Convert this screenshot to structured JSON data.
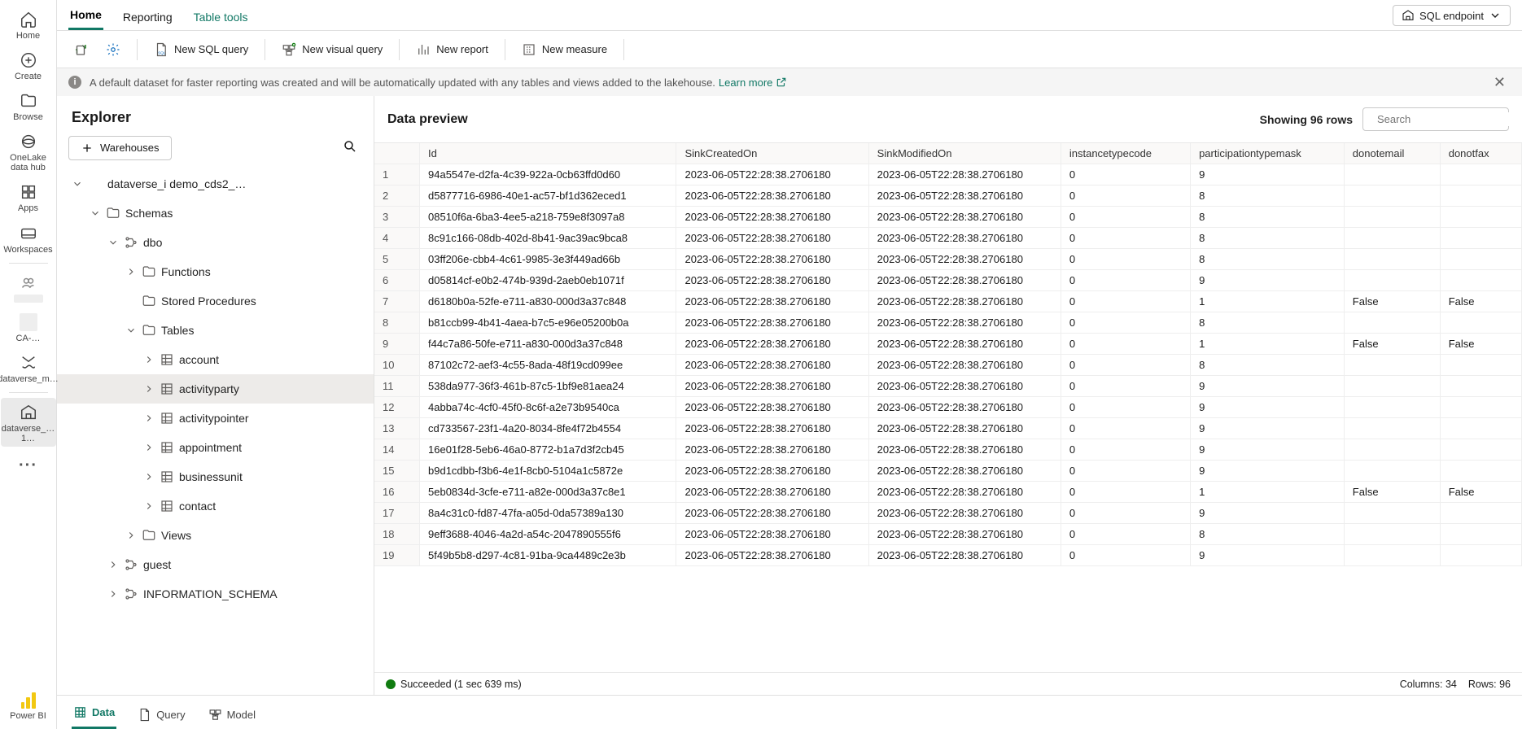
{
  "rail": {
    "home": "Home",
    "create": "Create",
    "browse": "Browse",
    "onelake": "OneLake data hub",
    "apps": "Apps",
    "workspaces": "Workspaces",
    "ws_avatar": "",
    "ws_ca": "CA-…",
    "ws_dvm": "dataverse_m…",
    "ws_dvi": "dataverse_…1…",
    "powerbi": "Power BI"
  },
  "tabs": {
    "home": "Home",
    "reporting": "Reporting",
    "tabletools": "Table tools",
    "mode": "SQL endpoint"
  },
  "toolbar": {
    "refresh": "",
    "settings": "",
    "newsql": "New SQL query",
    "newvisual": "New visual query",
    "newreport": "New report",
    "newmeasure": "New measure"
  },
  "banner": {
    "text": "A default dataset for faster reporting was created and will be automatically updated with any tables and views added to the lakehouse.",
    "learn": "Learn more"
  },
  "explorer": {
    "title": "Explorer",
    "warehouses": "Warehouses",
    "root": "dataverse_i          demo_cds2_…",
    "schemas": "Schemas",
    "dbo": "dbo",
    "functions": "Functions",
    "sprocs": "Stored Procedures",
    "tables": "Tables",
    "table_list": [
      "account",
      "activityparty",
      "activitypointer",
      "appointment",
      "businessunit",
      "contact"
    ],
    "views": "Views",
    "guest": "guest",
    "infoschema": "INFORMATION_SCHEMA"
  },
  "preview": {
    "title": "Data preview",
    "showing": "Showing 96 rows",
    "search_ph": "Search",
    "columns": [
      "Id",
      "SinkCreatedOn",
      "SinkModifiedOn",
      "instancetypecode",
      "participationtypemask",
      "donotemail",
      "donotfax"
    ],
    "rows": [
      {
        "n": 1,
        "Id": "94a5547e-d2fa-4c39-922a-0cb63ffd0d60",
        "SinkCreatedOn": "2023-06-05T22:28:38.2706180",
        "SinkModifiedOn": "2023-06-05T22:28:38.2706180",
        "instancetypecode": "0",
        "participationtypemask": "9",
        "donotemail": "",
        "donotfax": ""
      },
      {
        "n": 2,
        "Id": "d5877716-6986-40e1-ac57-bf1d362eced1",
        "SinkCreatedOn": "2023-06-05T22:28:38.2706180",
        "SinkModifiedOn": "2023-06-05T22:28:38.2706180",
        "instancetypecode": "0",
        "participationtypemask": "8",
        "donotemail": "",
        "donotfax": ""
      },
      {
        "n": 3,
        "Id": "08510f6a-6ba3-4ee5-a218-759e8f3097a8",
        "SinkCreatedOn": "2023-06-05T22:28:38.2706180",
        "SinkModifiedOn": "2023-06-05T22:28:38.2706180",
        "instancetypecode": "0",
        "participationtypemask": "8",
        "donotemail": "",
        "donotfax": ""
      },
      {
        "n": 4,
        "Id": "8c91c166-08db-402d-8b41-9ac39ac9bca8",
        "SinkCreatedOn": "2023-06-05T22:28:38.2706180",
        "SinkModifiedOn": "2023-06-05T22:28:38.2706180",
        "instancetypecode": "0",
        "participationtypemask": "8",
        "donotemail": "",
        "donotfax": ""
      },
      {
        "n": 5,
        "Id": "03ff206e-cbb4-4c61-9985-3e3f449ad66b",
        "SinkCreatedOn": "2023-06-05T22:28:38.2706180",
        "SinkModifiedOn": "2023-06-05T22:28:38.2706180",
        "instancetypecode": "0",
        "participationtypemask": "8",
        "donotemail": "",
        "donotfax": ""
      },
      {
        "n": 6,
        "Id": "d05814cf-e0b2-474b-939d-2aeb0eb1071f",
        "SinkCreatedOn": "2023-06-05T22:28:38.2706180",
        "SinkModifiedOn": "2023-06-05T22:28:38.2706180",
        "instancetypecode": "0",
        "participationtypemask": "9",
        "donotemail": "",
        "donotfax": ""
      },
      {
        "n": 7,
        "Id": "d6180b0a-52fe-e711-a830-000d3a37c848",
        "SinkCreatedOn": "2023-06-05T22:28:38.2706180",
        "SinkModifiedOn": "2023-06-05T22:28:38.2706180",
        "instancetypecode": "0",
        "participationtypemask": "1",
        "donotemail": "False",
        "donotfax": "False"
      },
      {
        "n": 8,
        "Id": "b81ccb99-4b41-4aea-b7c5-e96e05200b0a",
        "SinkCreatedOn": "2023-06-05T22:28:38.2706180",
        "SinkModifiedOn": "2023-06-05T22:28:38.2706180",
        "instancetypecode": "0",
        "participationtypemask": "8",
        "donotemail": "",
        "donotfax": ""
      },
      {
        "n": 9,
        "Id": "f44c7a86-50fe-e711-a830-000d3a37c848",
        "SinkCreatedOn": "2023-06-05T22:28:38.2706180",
        "SinkModifiedOn": "2023-06-05T22:28:38.2706180",
        "instancetypecode": "0",
        "participationtypemask": "1",
        "donotemail": "False",
        "donotfax": "False"
      },
      {
        "n": 10,
        "Id": "87102c72-aef3-4c55-8ada-48f19cd099ee",
        "SinkCreatedOn": "2023-06-05T22:28:38.2706180",
        "SinkModifiedOn": "2023-06-05T22:28:38.2706180",
        "instancetypecode": "0",
        "participationtypemask": "8",
        "donotemail": "",
        "donotfax": ""
      },
      {
        "n": 11,
        "Id": "538da977-36f3-461b-87c5-1bf9e81aea24",
        "SinkCreatedOn": "2023-06-05T22:28:38.2706180",
        "SinkModifiedOn": "2023-06-05T22:28:38.2706180",
        "instancetypecode": "0",
        "participationtypemask": "9",
        "donotemail": "",
        "donotfax": ""
      },
      {
        "n": 12,
        "Id": "4abba74c-4cf0-45f0-8c6f-a2e73b9540ca",
        "SinkCreatedOn": "2023-06-05T22:28:38.2706180",
        "SinkModifiedOn": "2023-06-05T22:28:38.2706180",
        "instancetypecode": "0",
        "participationtypemask": "9",
        "donotemail": "",
        "donotfax": ""
      },
      {
        "n": 13,
        "Id": "cd733567-23f1-4a20-8034-8fe4f72b4554",
        "SinkCreatedOn": "2023-06-05T22:28:38.2706180",
        "SinkModifiedOn": "2023-06-05T22:28:38.2706180",
        "instancetypecode": "0",
        "participationtypemask": "9",
        "donotemail": "",
        "donotfax": ""
      },
      {
        "n": 14,
        "Id": "16e01f28-5eb6-46a0-8772-b1a7d3f2cb45",
        "SinkCreatedOn": "2023-06-05T22:28:38.2706180",
        "SinkModifiedOn": "2023-06-05T22:28:38.2706180",
        "instancetypecode": "0",
        "participationtypemask": "9",
        "donotemail": "",
        "donotfax": ""
      },
      {
        "n": 15,
        "Id": "b9d1cdbb-f3b6-4e1f-8cb0-5104a1c5872e",
        "SinkCreatedOn": "2023-06-05T22:28:38.2706180",
        "SinkModifiedOn": "2023-06-05T22:28:38.2706180",
        "instancetypecode": "0",
        "participationtypemask": "9",
        "donotemail": "",
        "donotfax": ""
      },
      {
        "n": 16,
        "Id": "5eb0834d-3cfe-e711-a82e-000d3a37c8e1",
        "SinkCreatedOn": "2023-06-05T22:28:38.2706180",
        "SinkModifiedOn": "2023-06-05T22:28:38.2706180",
        "instancetypecode": "0",
        "participationtypemask": "1",
        "donotemail": "False",
        "donotfax": "False"
      },
      {
        "n": 17,
        "Id": "8a4c31c0-fd87-47fa-a05d-0da57389a130",
        "SinkCreatedOn": "2023-06-05T22:28:38.2706180",
        "SinkModifiedOn": "2023-06-05T22:28:38.2706180",
        "instancetypecode": "0",
        "participationtypemask": "9",
        "donotemail": "",
        "donotfax": ""
      },
      {
        "n": 18,
        "Id": "9eff3688-4046-4a2d-a54c-2047890555f6",
        "SinkCreatedOn": "2023-06-05T22:28:38.2706180",
        "SinkModifiedOn": "2023-06-05T22:28:38.2706180",
        "instancetypecode": "0",
        "participationtypemask": "8",
        "donotemail": "",
        "donotfax": ""
      },
      {
        "n": 19,
        "Id": "5f49b5b8-d297-4c81-91ba-9ca4489c2e3b",
        "SinkCreatedOn": "2023-06-05T22:28:38.2706180",
        "SinkModifiedOn": "2023-06-05T22:28:38.2706180",
        "instancetypecode": "0",
        "participationtypemask": "9",
        "donotemail": "",
        "donotfax": ""
      }
    ],
    "status": "Succeeded (1 sec 639 ms)",
    "cols_label": "Columns:",
    "cols_val": "34",
    "rows_label": "Rows:",
    "rows_val": "96"
  },
  "viewtabs": {
    "data": "Data",
    "query": "Query",
    "model": "Model"
  }
}
